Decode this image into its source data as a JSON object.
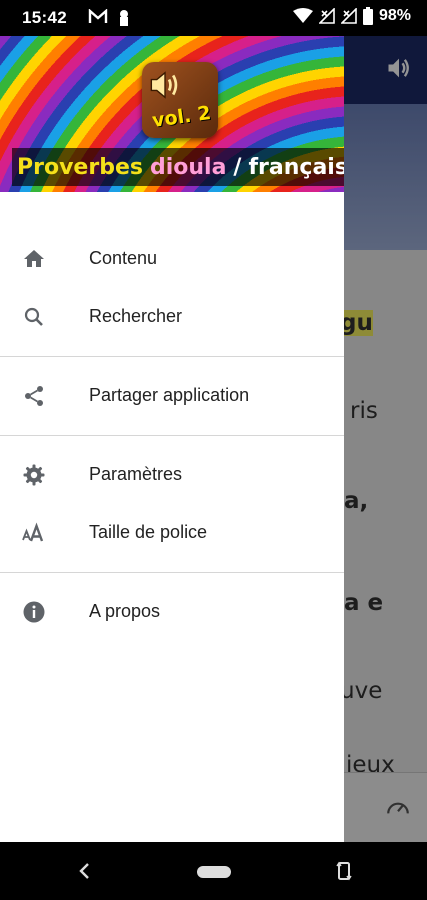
{
  "status_bar": {
    "time": "15:42",
    "battery": "98%",
    "icons": [
      "gmail-icon",
      "keyhole-icon",
      "wifi-icon",
      "signal-icon",
      "signal-icon",
      "battery-icon"
    ]
  },
  "background_app": {
    "lines": [
      "gu",
      "ris",
      "a,",
      "a e",
      "uve",
      "ieux"
    ]
  },
  "drawer": {
    "header": {
      "logo_text": "vol. 2",
      "title_part1": "Proverbes",
      "title_part2": "dioula",
      "title_sep": "/",
      "title_part3": "français"
    },
    "items": [
      {
        "label": "Contenu",
        "icon": "home-icon"
      },
      {
        "label": "Rechercher",
        "icon": "search-icon"
      },
      {
        "label": "Partager application",
        "icon": "share-icon"
      },
      {
        "label": "Paramètres",
        "icon": "gear-icon"
      },
      {
        "label": "Taille de police",
        "icon": "font-size-icon"
      },
      {
        "label": "A propos",
        "icon": "info-icon"
      }
    ]
  },
  "colors": {
    "toolbar": "#1c2a66",
    "icon": "#5f6368",
    "title_yellow": "#f5e11a",
    "title_pink": "#ff9fd8"
  }
}
